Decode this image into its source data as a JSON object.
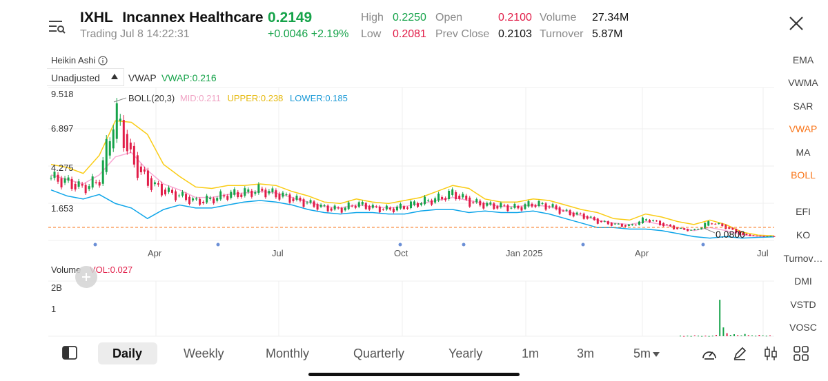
{
  "header": {
    "symbol": "IXHL",
    "name": "Incannex Healthcare",
    "price": "0.2149",
    "status": "Trading Jul 8 14:22:31",
    "change": "+0.0046 +2.19%",
    "quote": {
      "high_label": "High",
      "high": "0.2250",
      "open_label": "Open",
      "open": "0.2100",
      "volume_label": "Volume",
      "volume": "27.34M",
      "low_label": "Low",
      "low": "0.2081",
      "prev_close_label": "Prev Close",
      "prev_close": "0.2103",
      "turnover_label": "Turnover",
      "turnover": "5.87M"
    }
  },
  "chart": {
    "chart_type_label": "Heikin Ashi",
    "adjust_label": "Unadjusted",
    "vwap_label": "VWAP",
    "vwap_value": "VWAP:0.216",
    "boll_label": "BOLL(20,3)",
    "boll_mid": "MID:0.211",
    "boll_upper": "UPPER:0.238",
    "boll_lower": "LOWER:0.185",
    "current_price_line": "0.0800",
    "volume_label": "Volume",
    "vol_value": "VOL:0.027"
  },
  "chart_data": {
    "type": "line",
    "y_ticks": [
      "9.518",
      "6.897",
      "4.275",
      "1.653"
    ],
    "x_ticks": [
      "Apr",
      "Jul",
      "Oct",
      "Jan 2025",
      "Apr",
      "Jul"
    ],
    "ylim": [
      0.08,
      9.518
    ],
    "series": [
      {
        "name": "Price",
        "values": [
          4.1,
          3.8,
          3.4,
          4.0,
          8.6,
          5.2,
          3.8,
          3.2,
          2.9,
          2.5,
          2.7,
          3.0,
          3.1,
          3.3,
          3.0,
          2.7,
          2.4,
          2.1,
          2.0,
          2.4,
          2.1,
          2.0,
          2.2,
          2.5,
          2.7,
          3.1,
          2.5,
          2.3,
          2.2,
          2.1,
          2.4,
          2.2,
          1.8,
          1.6,
          1.2,
          1.0,
          0.9,
          1.4,
          1.0,
          0.7,
          0.6,
          1.2,
          0.8,
          0.3,
          0.22,
          0.21
        ]
      },
      {
        "name": "UPPER",
        "values": [
          5.0,
          4.8,
          4.4,
          5.6,
          7.9,
          7.8,
          7.0,
          5.0,
          4.2,
          3.5,
          3.4,
          3.6,
          3.6,
          3.7,
          3.6,
          3.2,
          2.9,
          2.5,
          2.4,
          2.7,
          2.5,
          2.4,
          2.6,
          2.8,
          3.2,
          3.6,
          3.4,
          2.7,
          2.5,
          2.5,
          2.7,
          2.6,
          2.3,
          2.0,
          1.8,
          1.4,
          1.3,
          1.7,
          1.5,
          1.2,
          1.0,
          1.3,
          1.0,
          0.5,
          0.3,
          0.25
        ]
      },
      {
        "name": "MID",
        "values": [
          4.3,
          4.0,
          3.7,
          4.3,
          5.5,
          5.8,
          4.6,
          3.7,
          3.3,
          2.8,
          2.8,
          3.0,
          3.1,
          3.2,
          3.1,
          2.8,
          2.5,
          2.2,
          2.1,
          2.3,
          2.2,
          2.1,
          2.2,
          2.4,
          2.6,
          2.8,
          2.6,
          2.4,
          2.2,
          2.2,
          2.3,
          2.2,
          1.9,
          1.6,
          1.3,
          1.1,
          1.0,
          1.2,
          1.0,
          0.8,
          0.6,
          0.8,
          0.6,
          0.3,
          0.22,
          0.21
        ]
      },
      {
        "name": "LOWER",
        "values": [
          3.3,
          2.9,
          2.7,
          3.0,
          2.4,
          2.1,
          1.4,
          2.0,
          2.3,
          2.1,
          2.1,
          2.3,
          2.5,
          2.6,
          2.5,
          2.3,
          2.0,
          1.8,
          1.7,
          1.8,
          1.8,
          1.7,
          1.7,
          1.9,
          2.0,
          2.0,
          1.8,
          1.9,
          1.8,
          1.8,
          1.9,
          1.7,
          1.4,
          1.1,
          0.8,
          0.8,
          0.7,
          0.7,
          0.6,
          0.4,
          0.2,
          0.1,
          0.2,
          0.1,
          0.15,
          0.18
        ]
      }
    ],
    "volume": {
      "y_ticks": [
        "2B",
        "1"
      ],
      "ylim": [
        0,
        2
      ],
      "values": [
        0.02,
        0.01,
        0.02,
        0.01,
        0.03,
        0.02,
        0.01,
        0.02,
        0.01,
        0.02,
        0.05,
        1.45,
        0.35,
        0.12,
        0.05,
        0.08,
        0.04,
        0.03,
        0.09,
        0.04,
        0.03,
        0.02,
        0.05,
        0.03,
        0.02,
        0.03
      ]
    }
  },
  "indicators": [
    "EMA",
    "VWMA",
    "SAR",
    "VWAP",
    "MA",
    "BOLL",
    "EFI",
    "KO",
    "Turnov…",
    "DMI",
    "VSTD",
    "VOSC"
  ],
  "active_indicators": [
    "VWAP",
    "BOLL"
  ],
  "periods": [
    "Daily",
    "Weekly",
    "Monthly",
    "Quarterly",
    "Yearly",
    "1m",
    "3m",
    "5m"
  ],
  "active_period": "Daily",
  "colors": {
    "up": "#16a34a",
    "down": "#e11d48",
    "upper": "#facc15",
    "mid": "#f9a8d4",
    "lower": "#0ea5e9",
    "accent": "#f97316"
  },
  "icons": [
    "menu-search-icon",
    "close-icon",
    "info-icon",
    "triangle-up-icon",
    "panel-toggle-icon",
    "gauge-icon",
    "pen-icon",
    "candle-settings-icon",
    "grid-icon",
    "add-icon",
    "dropdown-icon"
  ]
}
